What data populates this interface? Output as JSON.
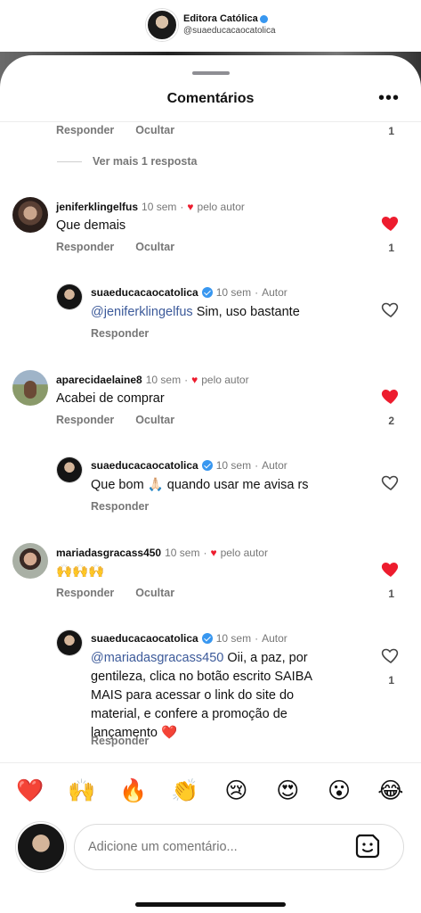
{
  "profile": {
    "name": "Editora Católica",
    "handle": "@suaeducacaocatolica"
  },
  "sheet": {
    "title": "Comentários",
    "more_label": "•••"
  },
  "top_thread": {
    "reply_label": "Responder",
    "hide_label": "Ocultar",
    "likes": "1",
    "more_replies_label": "Ver mais 1 resposta"
  },
  "comments": [
    {
      "user": "jeniferklingelfus",
      "time": "10 sem",
      "liked_by_author": "pelo autor",
      "text": "Que demais",
      "reply_label": "Responder",
      "hide_label": "Ocultar",
      "likes": "1",
      "reply": {
        "user": "suaeducacaocatolica",
        "time": "10 sem",
        "role": "Autor",
        "mention": "@jeniferklingelfus",
        "text": " Sim, uso bastante",
        "reply_label": "Responder"
      }
    },
    {
      "user": "aparecidaelaine8",
      "time": "10 sem",
      "liked_by_author": "pelo autor",
      "text": "Acabei de comprar",
      "reply_label": "Responder",
      "hide_label": "Ocultar",
      "likes": "2",
      "reply": {
        "user": "suaeducacaocatolica",
        "time": "10 sem",
        "role": "Autor",
        "mention": "",
        "text": "Que bom 🙏🏻 quando usar me avisa rs",
        "reply_label": "Responder"
      }
    },
    {
      "user": "mariadasgracass450",
      "time": "10 sem",
      "liked_by_author": "pelo autor",
      "text": "🙌🙌🙌",
      "reply_label": "Responder",
      "hide_label": "Ocultar",
      "likes": "1",
      "reply": {
        "user": "suaeducacaocatolica",
        "time": "10 sem",
        "role": "Autor",
        "mention": "@mariadasgracass450",
        "text": " Oii, a paz, por gentileza, clica no botão escrito SAIBA MAIS para acessar o link do site do material, e confere a promoção de lançamento ❤️",
        "reply_label": "Responder",
        "likes": "1"
      }
    }
  ],
  "emoji_bar": [
    "❤️",
    "🙌",
    "🔥",
    "👏",
    "😢",
    "😍",
    "😮",
    "😂"
  ],
  "composer": {
    "placeholder": "Adicione um comentário..."
  },
  "icons": {
    "heart_filled": "heart-filled-icon",
    "heart_outline": "heart-outline-icon",
    "sticker": "sticker-icon",
    "verified": "verified-badge-icon"
  },
  "colors": {
    "heart": "#ed1c2e",
    "verified": "#3897f0",
    "mention": "#3c5a9a"
  }
}
